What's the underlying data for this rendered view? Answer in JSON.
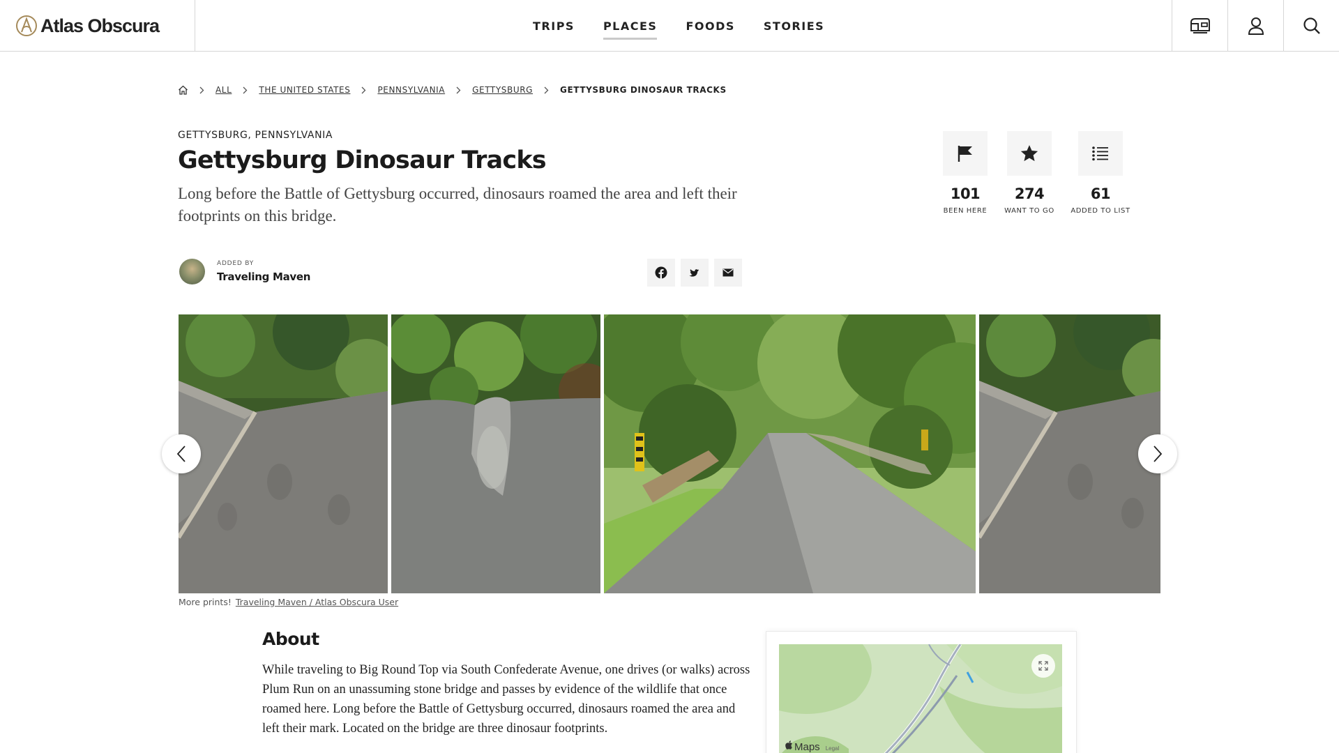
{
  "header": {
    "logo_text": "Atlas Obscura",
    "nav": [
      {
        "label": "TRIPS"
      },
      {
        "label": "PLACES",
        "active": true
      },
      {
        "label": "FOODS"
      },
      {
        "label": "STORIES"
      }
    ],
    "icons": [
      "mailbox-icon",
      "user-icon",
      "search-icon"
    ]
  },
  "breadcrumb": {
    "items": [
      "All",
      "The United States",
      "Pennsylvania",
      "Gettysburg"
    ],
    "current": "Gettysburg Dinosaur Tracks"
  },
  "place": {
    "location": "Gettysburg, Pennsylvania",
    "title": "Gettysburg Dinosaur Tracks",
    "subtitle": "Long before the Battle of Gettysburg occurred, dinosaurs roamed the area and left their footprints on this bridge."
  },
  "stats": [
    {
      "icon": "flag-icon",
      "value": "101",
      "label": "Been Here"
    },
    {
      "icon": "star-icon",
      "value": "274",
      "label": "Want to Go"
    },
    {
      "icon": "list-icon",
      "value": "61",
      "label": "Added to List"
    }
  ],
  "added_by": {
    "label": "Added by",
    "name": "Traveling Maven"
  },
  "share": [
    "facebook-icon",
    "twitter-icon",
    "email-icon"
  ],
  "gallery": {
    "caption": "More prints!",
    "credit": "Traveling Maven / Atlas Obscura User"
  },
  "about": {
    "heading": "About",
    "text": "While traveling to Big Round Top via South Confederate Avenue, one drives (or walks) across Plum Run on an unassuming stone bridge and passes by evidence of the wildlife that once roamed here. Long before the Battle of Gettysburg occurred, dinosaurs roamed the area and left their mark. Located on the bridge are three dinosaur footprints."
  },
  "map": {
    "brand": "Maps",
    "legal": "Legal"
  },
  "colors": {
    "text": "#1b1b1b",
    "border": "#d6d6d6",
    "stat_bg": "#f5f5f5"
  }
}
